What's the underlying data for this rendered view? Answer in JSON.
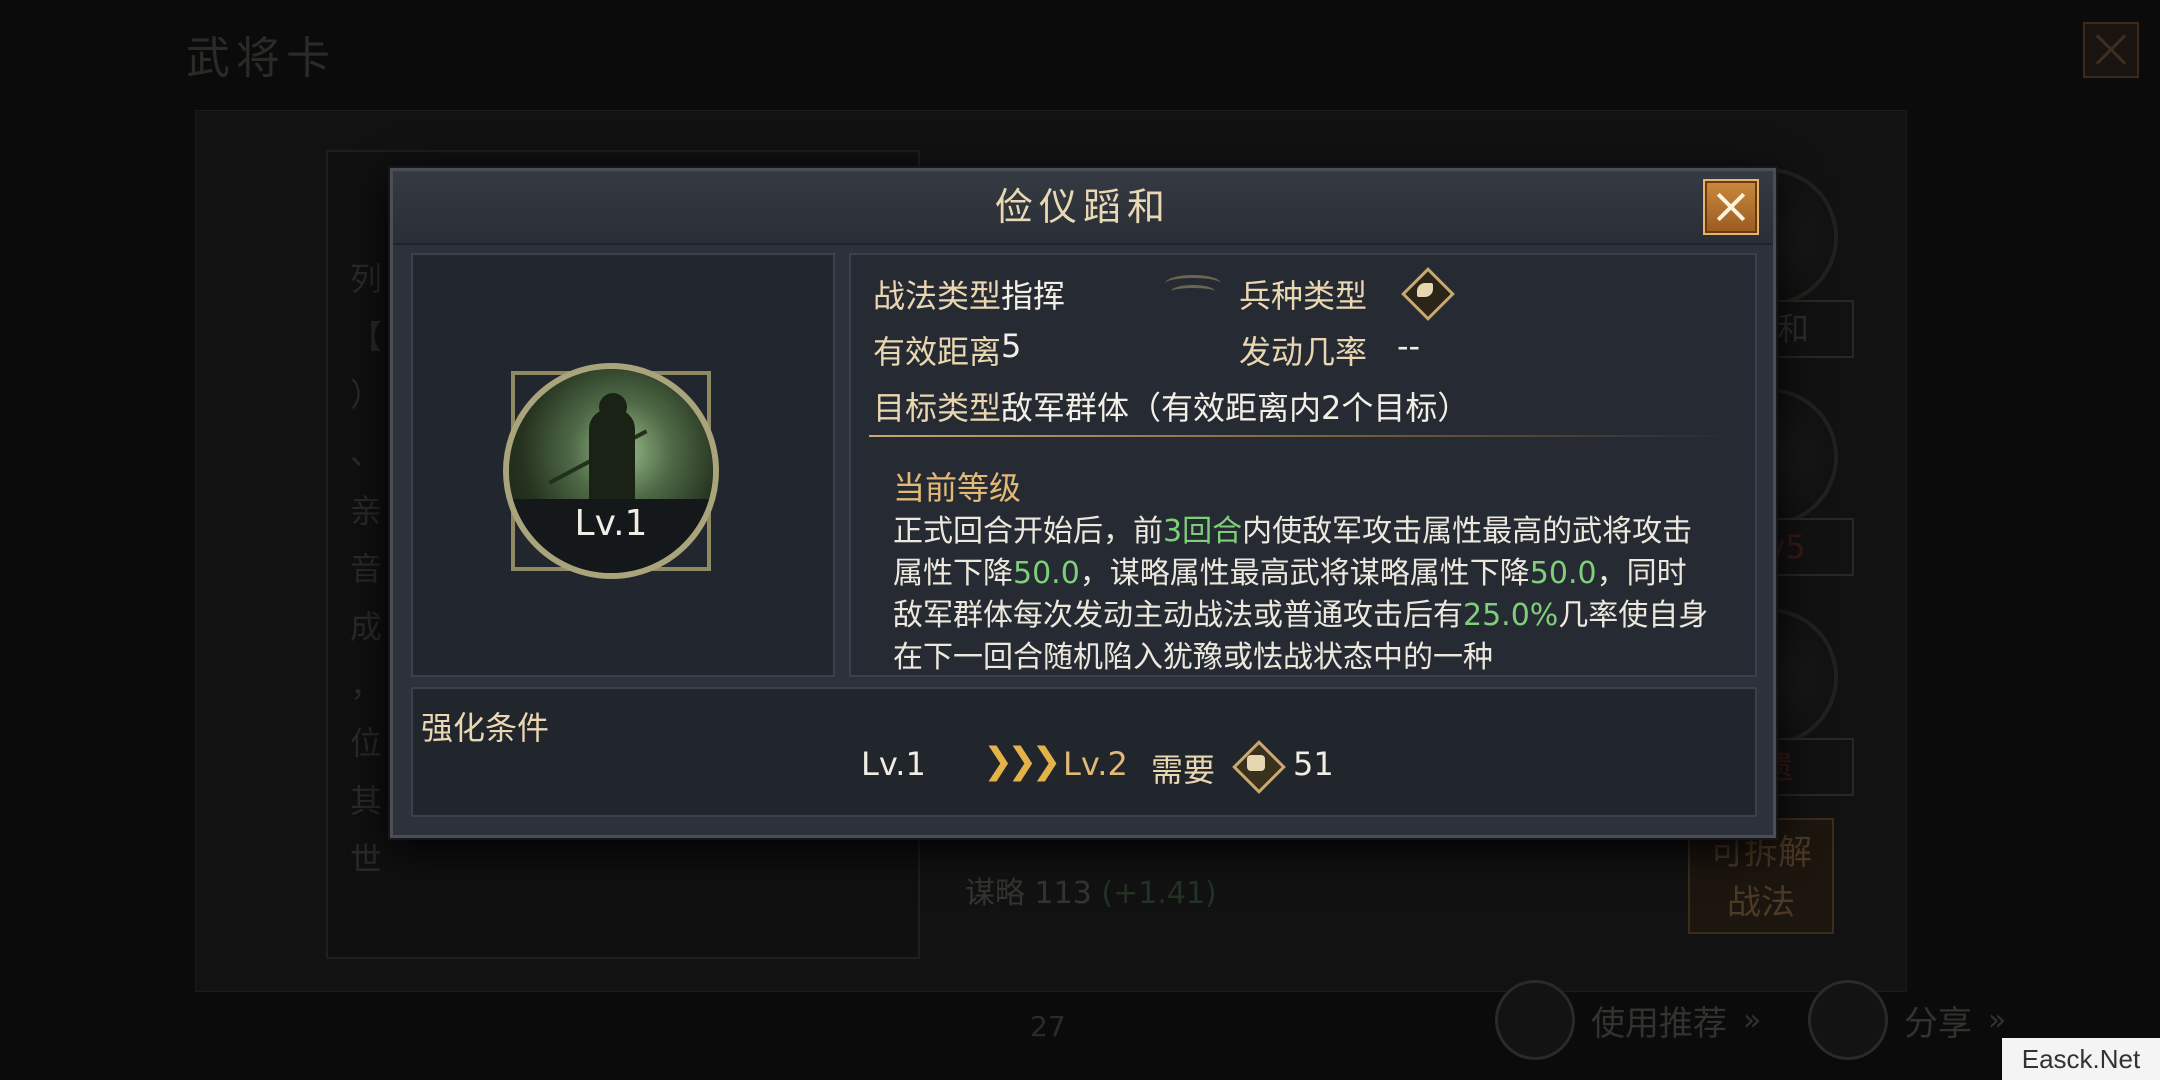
{
  "background": {
    "page_title": "武将卡",
    "left_text_chars": [
      "列",
      "【",
      "）",
      "、",
      "亲",
      "音",
      "成",
      "，",
      "位",
      "其",
      "世"
    ],
    "side_tags": [
      "蹈和",
      "Lv5",
      "遗"
    ],
    "decompose_button": "可拆解\n战法",
    "stat_label": "谋略",
    "stat_value": "113",
    "stat_bonus": "(+1.41)",
    "page_number": "27",
    "recommend_button": "使用推荐",
    "share_button": "分享",
    "arrow_glyph": "»"
  },
  "watermark": "Easck.Net",
  "modal": {
    "title": "俭仪蹈和",
    "skill_level": "Lv.1",
    "info": {
      "type_label": "战法类型",
      "type_value": "指挥",
      "range_label": "有效距离",
      "range_value": "5",
      "target_label": "目标类型",
      "target_value": "敌军群体（有效距离内2个目标）",
      "troop_label": "兵种类型",
      "troop_icon": "horse-icon",
      "rate_label": "发动几率",
      "rate_value": "--"
    },
    "current_level_label": "当前等级",
    "description": {
      "p1": "正式回合开始后，前",
      "h1": "3回合",
      "p2": "内使敌军攻击属性最高的武将攻击属性下降",
      "h2": "50.0",
      "p3": "，谋略属性最高武将谋略属性下降",
      "h3": "50.0",
      "p4": "，同时敌军群体每次发动主动战法或普通攻击后有",
      "h4": "25.0%",
      "p5": "几率使自身在下一回合随机陷入犹豫或怯战状态中的一种"
    },
    "enhance": {
      "label": "强化条件",
      "from_level": "Lv.1",
      "arrows": "❯❯❯",
      "to_level": "Lv.2",
      "need_label": "需要",
      "cost_icon": "fist-icon",
      "cost_value": "51"
    }
  },
  "colors": {
    "highlight_green": "#7fcf79",
    "gold": "#e3b976",
    "close_orange": "#c98a3d"
  }
}
